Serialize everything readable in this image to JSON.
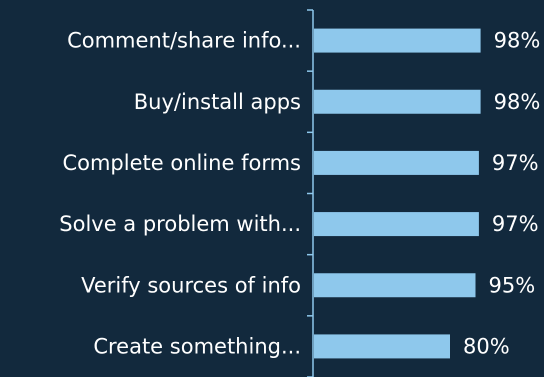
{
  "chart_data": {
    "type": "bar",
    "orientation": "horizontal",
    "categories": [
      "Comment/share info...",
      "Buy/install apps",
      "Complete online forms",
      "Solve a problem with...",
      "Verify sources of info",
      "Create something..."
    ],
    "values": [
      98,
      98,
      97,
      97,
      95,
      80
    ],
    "value_labels": [
      "98%",
      "98%",
      "97%",
      "97%",
      "95%",
      "80%"
    ],
    "title": "",
    "xlabel": "",
    "ylabel": "",
    "xlim": [
      0,
      100
    ],
    "grid": false,
    "legend": "none",
    "colors": {
      "background": "#12293d",
      "bar": "#8ec8ec",
      "axis": "#8ec8ec",
      "text": "#ffffff"
    }
  }
}
